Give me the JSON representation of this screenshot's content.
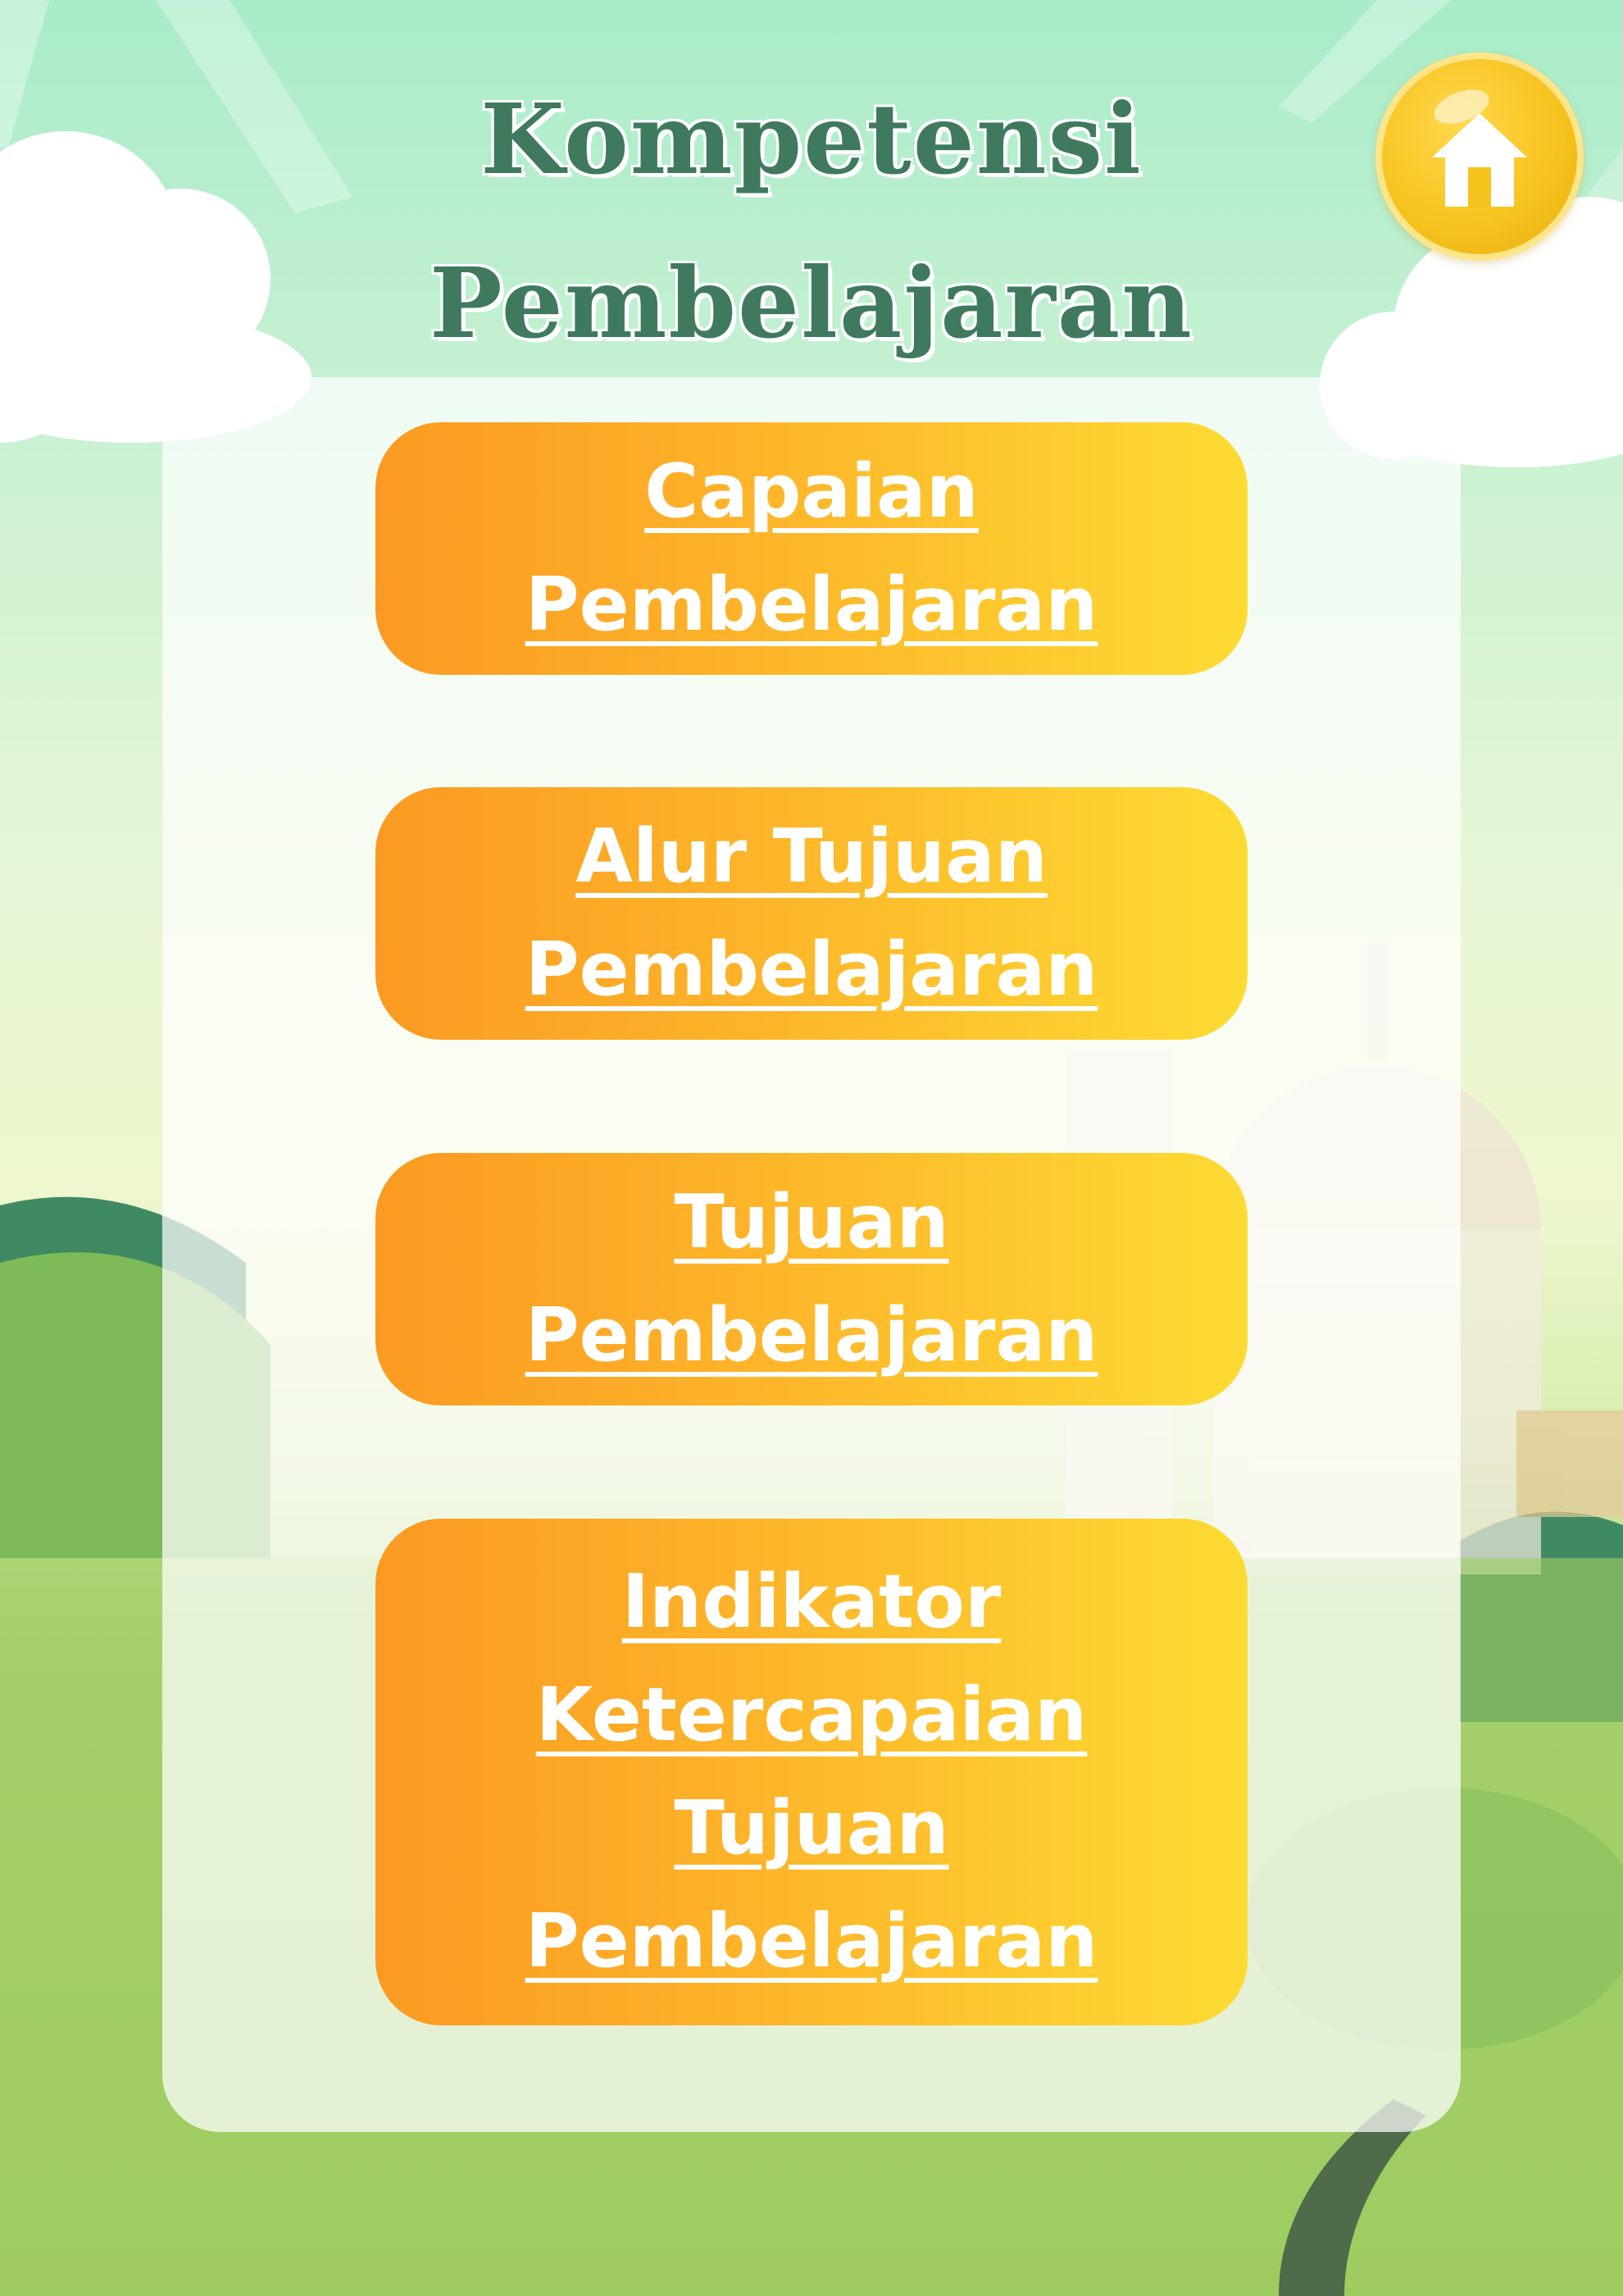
{
  "page": {
    "title_line1": "Kompetensi",
    "title_line2": "Pembelajaran"
  },
  "home_button": {
    "icon": "home-icon"
  },
  "menu": [
    {
      "line1": "Capaian",
      "line2": "Pembelajaran"
    },
    {
      "line1": "Alur Tujuan",
      "line2": "Pembelajaran"
    },
    {
      "line1": "Tujuan",
      "line2": "Pembelajaran"
    },
    {
      "line1": "Indikator",
      "line2": "Ketercapaian",
      "line3": "Tujuan",
      "line4": "Pembelajaran"
    }
  ],
  "colors": {
    "title": "#3f7a5e",
    "button_gradient_start": "#fb9a22",
    "button_gradient_end": "#fddb33",
    "home_button": "#f6c21c"
  }
}
